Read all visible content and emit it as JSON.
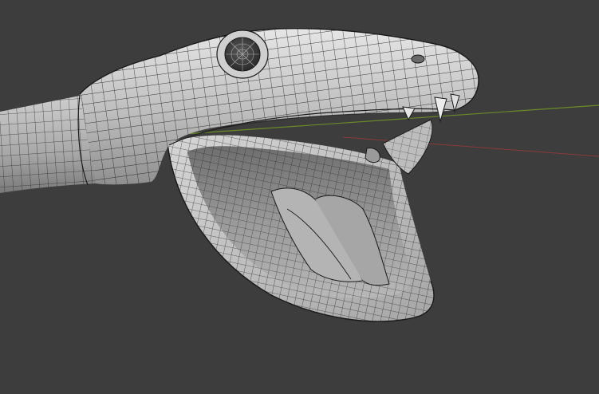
{
  "viewport": {
    "background_color": "#3d3d3d",
    "mode": "3d-viewport"
  },
  "axes": {
    "x_axis_color": "#8a3a3a",
    "y_axis_color": "#6a8a2a"
  },
  "mesh": {
    "subject": "snake-head-open-mouth",
    "display": "wireframe-overlay",
    "surface_color": "#c9c9c9",
    "inner_color": "#9c9c9c",
    "wire_color": "#1a1a1a"
  }
}
